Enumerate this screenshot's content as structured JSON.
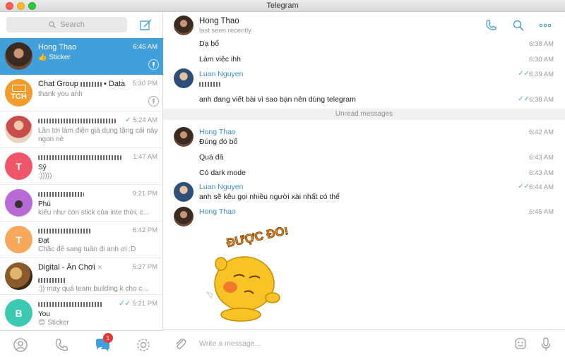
{
  "window": {
    "title": "Telegram"
  },
  "sidebar": {
    "search_placeholder": "Search",
    "chats": [
      {
        "name": "Hong Thao",
        "time": "6:45 AM",
        "preview": "👍 Sticker",
        "pinned": true,
        "active": true,
        "avatar_letter": "",
        "avatar_color": "#5d4a3a"
      },
      {
        "name": "Chat Group",
        "name_suffix": "Data Analyst",
        "time": "5:30 PM",
        "preview": "thank you anh",
        "pinned": true,
        "avatar_letter": "TCH",
        "avatar_color": "#f39c2c"
      },
      {
        "name": "",
        "time": "5:24 AM",
        "preview": "Lần tới làm điện giả dụng tặng cái này ngon nè",
        "read": true,
        "avatar_letter": "",
        "avatar_color": "#c94d4d"
      },
      {
        "name": "",
        "time": "1:47 AM",
        "preview": "Sỹ",
        "preview2": ":)))))",
        "avatar_letter": "T",
        "avatar_color": "#f0566a"
      },
      {
        "name": "",
        "time": "9:21 PM",
        "preview": "Phú",
        "preview2": "kiểu như con stick của inte thời, c...",
        "avatar_letter": "",
        "avatar_color": "#b86ad6"
      },
      {
        "name": "",
        "time": "6:42 PM",
        "preview": "Đạt",
        "preview2": "Chắc để sang tuần đi anh ơi :D",
        "avatar_letter": "T",
        "avatar_color": "#f7a85b"
      },
      {
        "name": "Digital - Ăn Chơi",
        "time": "5:37 PM",
        "preview": ":)) may quá team building k cho c...",
        "avatar_letter": "",
        "avatar_color": "#b07b3a"
      },
      {
        "name": "",
        "time": "5:21 PM",
        "preview": "You",
        "preview2": "😊 Sticker",
        "read": true,
        "avatar_letter": "B",
        "avatar_color": "#3cc9b2"
      }
    ],
    "tabs": {
      "contacts": "contacts",
      "calls": "calls",
      "chats_badge": "1",
      "settings": "settings"
    }
  },
  "chat": {
    "title": "Hong Thao",
    "status": "last seen recently",
    "messages": [
      {
        "text": "Dạ bổ",
        "time": "6:38 AM"
      },
      {
        "text": "Làm việc ihh",
        "time": "6:30 AM"
      },
      {
        "author": "Luan Nguyen",
        "text": "",
        "time": "6:39 AM",
        "read": true
      },
      {
        "text": "anh đang viết bài vì sao bạn nên dùng telegram",
        "time": "6:38 AM",
        "read": true
      }
    ],
    "unread_label": "Unread messages",
    "messages2": [
      {
        "author": "Hong Thao",
        "text": "Đúng đó bổ",
        "time": "6:42 AM"
      },
      {
        "text": "Quá đã",
        "time": "6:43 AM"
      },
      {
        "text": "Có dark mode",
        "time": "6:43 AM"
      },
      {
        "author": "Luan Nguyen",
        "text": "anh sẽ kêu gọi nhiều người xài nhất có thể",
        "time": "6:44 AM",
        "read": true
      },
      {
        "author": "Hong Thao",
        "text": "",
        "time": "6:45 AM"
      }
    ],
    "sticker_text": "ĐƯỢC ĐÓ!",
    "composer_placeholder": "Write a message..."
  },
  "colors": {
    "accent": "#419fd9",
    "name_blue": "#3b8fd1"
  }
}
